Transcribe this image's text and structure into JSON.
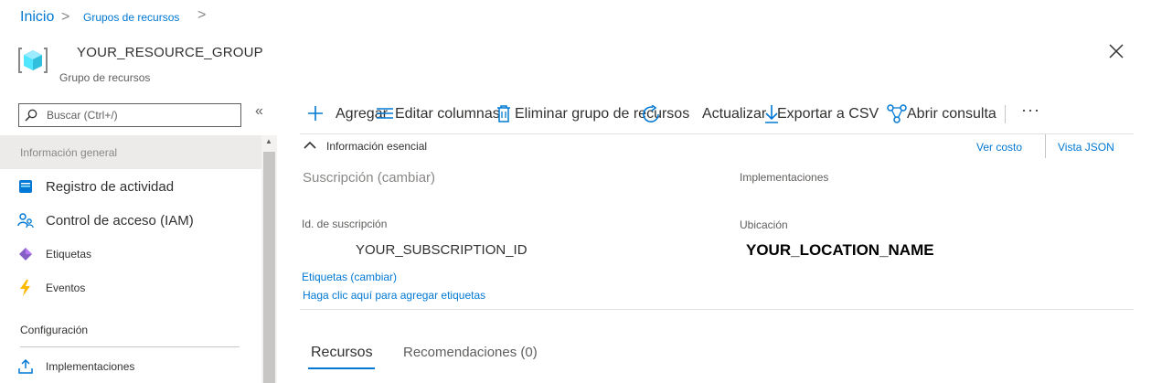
{
  "breadcrumb": {
    "home": "Inicio",
    "sep": ">",
    "resource_groups": "Grupos de recursos",
    "sep2": ">"
  },
  "header": {
    "title": "YOUR_RESOURCE_GROUP",
    "subtitle": "Grupo de recursos",
    "icon": "resource-group-icon"
  },
  "sidebar": {
    "search_placeholder": "Buscar (Ctrl+/)",
    "collapse": "«",
    "selected_item": "Información general",
    "items": [
      {
        "label": "Registro de actividad",
        "icon": "activity-log-icon"
      },
      {
        "label": "Control de acceso (IAM)",
        "icon": "iam-icon"
      },
      {
        "label": "Etiquetas",
        "icon": "tag-icon"
      },
      {
        "label": "Eventos",
        "icon": "lightning-icon"
      }
    ],
    "section_config": "Configuración",
    "config_items": [
      {
        "label": "Implementaciones",
        "icon": "deploy-icon"
      }
    ]
  },
  "toolbar": {
    "add": "Agregar",
    "edit_columns": "Editar columnas",
    "delete": "Eliminar grupo de recursos",
    "refresh": "Actualizar",
    "export": "Exportar a CSV",
    "open_query": "Abrir consulta",
    "more": "···"
  },
  "essentials": {
    "title": "Información esencial",
    "ver_costo": "Ver costo",
    "vista_json": "Vista JSON",
    "subscription_label": "Suscripción (cambiar)",
    "deployments_label": "Implementaciones",
    "subscription_id_label": "Id. de suscripción",
    "subscription_id": "YOUR_SUBSCRIPTION_ID",
    "location_label": "Ubicación",
    "location": "YOUR_LOCATION_NAME",
    "tags_label": "Etiquetas (cambiar)",
    "add_tags": "Haga clic aquí para agregar etiquetas"
  },
  "tabs": {
    "resources": "Recursos",
    "recommendations": "Recomendaciones (0)"
  },
  "colors": {
    "accent": "#0078d4",
    "text": "#323130",
    "muted": "#605e5c",
    "selected_bg": "#edebe9"
  }
}
